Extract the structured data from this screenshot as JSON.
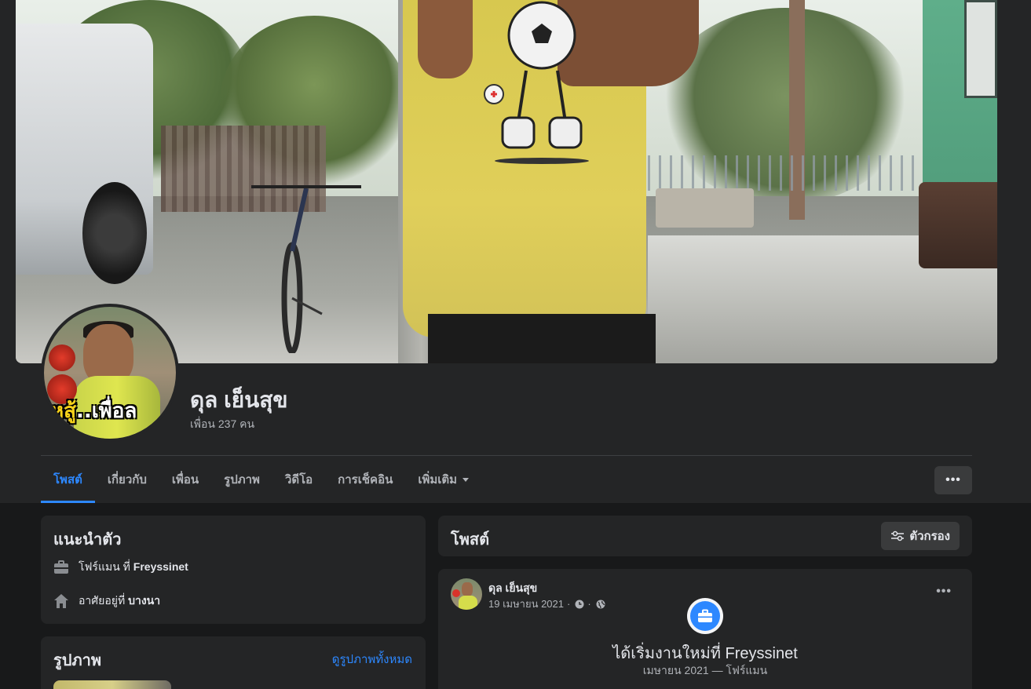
{
  "profile": {
    "name": "ดุล เย็นสุข",
    "friends": "เพื่อน 237 คน",
    "avatar_sticker_yellow": "หสู้",
    "avatar_sticker_white": "..เพื่อล"
  },
  "tabs": [
    {
      "label": "โพสต์",
      "active": true
    },
    {
      "label": "เกี่ยวกับ",
      "active": false
    },
    {
      "label": "เพื่อน",
      "active": false
    },
    {
      "label": "รูปภาพ",
      "active": false
    },
    {
      "label": "วิดีโอ",
      "active": false
    },
    {
      "label": "การเช็คอิน",
      "active": false
    },
    {
      "label": "เพิ่มเติม",
      "active": false
    }
  ],
  "more_button": "•••",
  "intro": {
    "title": "แนะนำตัว",
    "work_prefix": "โฟร์แมน ที่ ",
    "work_company": "Freyssinet",
    "home_prefix": "อาศัยอยู่ที่ ",
    "home_city": "บางนา"
  },
  "photos": {
    "title": "รูปภาพ",
    "see_all": "ดูรูปภาพทั้งหมด"
  },
  "posts": {
    "title": "โพสต์",
    "filter_label": "ตัวกรอง"
  },
  "post": {
    "author": "ดุล เย็นสุข",
    "date": "19 เมษายน 2021",
    "dot": "·",
    "more": "•••",
    "life_event_title": "ได้เริ่มงานใหม่ที่ Freyssinet",
    "life_event_sub": "เมษายน 2021 — โฟร์แมน"
  },
  "colors": {
    "accent": "#2d88ff",
    "card": "#242526",
    "background": "#18191a"
  }
}
